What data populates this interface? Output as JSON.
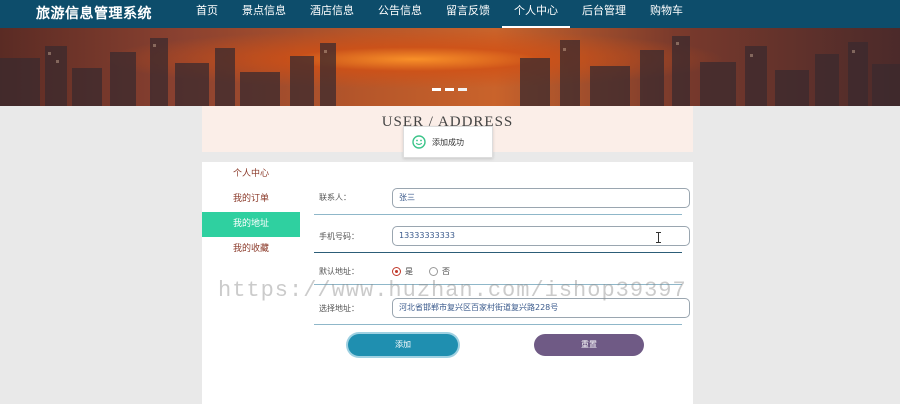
{
  "header": {
    "brand": "旅游信息管理系统",
    "nav": [
      {
        "label": "首页",
        "active": false
      },
      {
        "label": "景点信息",
        "active": false
      },
      {
        "label": "酒店信息",
        "active": false
      },
      {
        "label": "公告信息",
        "active": false
      },
      {
        "label": "留言反馈",
        "active": false
      },
      {
        "label": "个人中心",
        "active": true
      },
      {
        "label": "后台管理",
        "active": false
      },
      {
        "label": "购物车",
        "active": false
      }
    ]
  },
  "section": {
    "title": "USER / ADDRESS"
  },
  "toast": {
    "text": "添加成功",
    "icon": "smile-icon"
  },
  "sidebar": {
    "items": [
      {
        "label": "个人中心",
        "active": false
      },
      {
        "label": "我的订单",
        "active": false
      },
      {
        "label": "我的地址",
        "active": true
      },
      {
        "label": "我的收藏",
        "active": false
      }
    ]
  },
  "form": {
    "contact_label": "联系人：",
    "contact_value": "张三",
    "phone_label": "手机号码：",
    "phone_value": "13333333333",
    "default_label": "默认地址：",
    "default_yes": "是",
    "default_no": "否",
    "default_selected": "是",
    "address_label": "选择地址：",
    "address_value": "河北省邯郸市复兴区百家村街道复兴路228号",
    "add_button": "添加",
    "reset_button": "重置"
  },
  "watermark": "https://www.huzhan.com/ishop39397",
  "colors": {
    "topbar": "#0d4d6b",
    "active_sidebar": "#2fd0a0",
    "add_button": "#1f8fb0",
    "reset_button": "#6f5a85"
  }
}
